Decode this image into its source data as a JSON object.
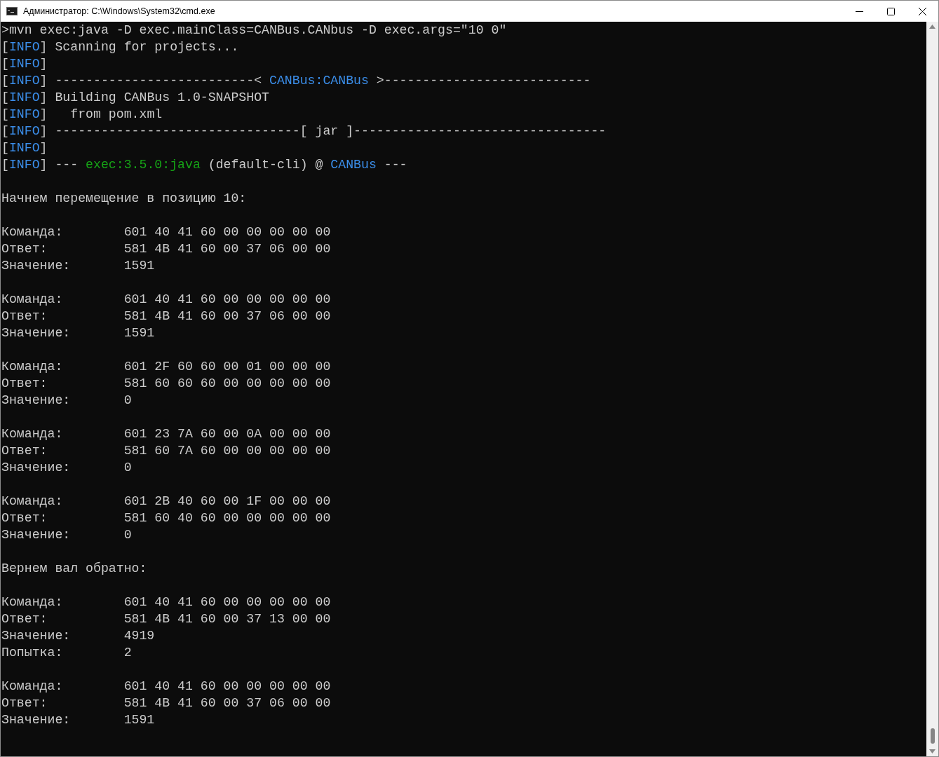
{
  "window": {
    "title": "Администратор: C:\\Windows\\System32\\cmd.exe"
  },
  "console": {
    "lines": [
      {
        "kind": "log",
        "segments": [
          {
            "text": ">mvn exec:java -D exec.mainClass=CANBus.CANbus -D exec.args=\"10 0\"",
            "kind": "plain"
          }
        ]
      },
      {
        "kind": "log",
        "segments": [
          {
            "text": "[",
            "kind": "plain"
          },
          {
            "text": "INFO",
            "kind": "accent"
          },
          {
            "text": "] Scanning for projects...",
            "kind": "plain"
          }
        ]
      },
      {
        "kind": "log",
        "segments": [
          {
            "text": "[",
            "kind": "plain"
          },
          {
            "text": "INFO",
            "kind": "accent"
          },
          {
            "text": "]",
            "kind": "plain"
          }
        ]
      },
      {
        "kind": "log",
        "segments": [
          {
            "text": "[",
            "kind": "plain"
          },
          {
            "text": "INFO",
            "kind": "accent"
          },
          {
            "text": "] --------------------------< ",
            "kind": "plain"
          },
          {
            "text": "CANBus:CANBus",
            "kind": "accent"
          },
          {
            "text": " >---------------------------",
            "kind": "plain"
          }
        ]
      },
      {
        "kind": "log",
        "segments": [
          {
            "text": "[",
            "kind": "plain"
          },
          {
            "text": "INFO",
            "kind": "accent"
          },
          {
            "text": "] Building CANBus 1.0-SNAPSHOT",
            "kind": "plain"
          }
        ]
      },
      {
        "kind": "log",
        "segments": [
          {
            "text": "[",
            "kind": "plain"
          },
          {
            "text": "INFO",
            "kind": "accent"
          },
          {
            "text": "]   from pom.xml",
            "kind": "plain"
          }
        ]
      },
      {
        "kind": "log",
        "segments": [
          {
            "text": "[",
            "kind": "plain"
          },
          {
            "text": "INFO",
            "kind": "accent"
          },
          {
            "text": "] --------------------------------[ jar ]---------------------------------",
            "kind": "plain"
          }
        ]
      },
      {
        "kind": "log",
        "segments": [
          {
            "text": "[",
            "kind": "plain"
          },
          {
            "text": "INFO",
            "kind": "accent"
          },
          {
            "text": "]",
            "kind": "plain"
          }
        ]
      },
      {
        "kind": "log",
        "segments": [
          {
            "text": "[",
            "kind": "plain"
          },
          {
            "text": "INFO",
            "kind": "accent"
          },
          {
            "text": "] --- ",
            "kind": "plain"
          },
          {
            "text": "exec:3.5.0:java",
            "kind": "success"
          },
          {
            "text": " (default-cli) @ ",
            "kind": "plain"
          },
          {
            "text": "CANBus",
            "kind": "accent"
          },
          {
            "text": " ---",
            "kind": "plain"
          }
        ]
      },
      {
        "kind": "blank"
      },
      {
        "kind": "log",
        "segments": [
          {
            "text": "Начнем перемещение в позицию 10:",
            "kind": "plain"
          }
        ]
      },
      {
        "kind": "blank"
      },
      {
        "kind": "field",
        "label": "Команда:",
        "value": "601 40 41 60 00 00 00 00 00"
      },
      {
        "kind": "field",
        "label": "Ответ:",
        "value": "581 4B 41 60 00 37 06 00 00"
      },
      {
        "kind": "field",
        "label": "Значение:",
        "value": "1591"
      },
      {
        "kind": "blank"
      },
      {
        "kind": "field",
        "label": "Команда:",
        "value": "601 40 41 60 00 00 00 00 00"
      },
      {
        "kind": "field",
        "label": "Ответ:",
        "value": "581 4B 41 60 00 37 06 00 00"
      },
      {
        "kind": "field",
        "label": "Значение:",
        "value": "1591"
      },
      {
        "kind": "blank"
      },
      {
        "kind": "field",
        "label": "Команда:",
        "value": "601 2F 60 60 00 01 00 00 00"
      },
      {
        "kind": "field",
        "label": "Ответ:",
        "value": "581 60 60 60 00 00 00 00 00"
      },
      {
        "kind": "field",
        "label": "Значение:",
        "value": "0"
      },
      {
        "kind": "blank"
      },
      {
        "kind": "field",
        "label": "Команда:",
        "value": "601 23 7A 60 00 0A 00 00 00"
      },
      {
        "kind": "field",
        "label": "Ответ:",
        "value": "581 60 7A 60 00 00 00 00 00"
      },
      {
        "kind": "field",
        "label": "Значение:",
        "value": "0"
      },
      {
        "kind": "blank"
      },
      {
        "kind": "field",
        "label": "Команда:",
        "value": "601 2B 40 60 00 1F 00 00 00"
      },
      {
        "kind": "field",
        "label": "Ответ:",
        "value": "581 60 40 60 00 00 00 00 00"
      },
      {
        "kind": "field",
        "label": "Значение:",
        "value": "0"
      },
      {
        "kind": "blank"
      },
      {
        "kind": "log",
        "segments": [
          {
            "text": "Вернем вал обратно:",
            "kind": "plain"
          }
        ]
      },
      {
        "kind": "blank"
      },
      {
        "kind": "field",
        "label": "Команда:",
        "value": "601 40 41 60 00 00 00 00 00"
      },
      {
        "kind": "field",
        "label": "Ответ:",
        "value": "581 4B 41 60 00 37 13 00 00"
      },
      {
        "kind": "field",
        "label": "Значение:",
        "value": "4919"
      },
      {
        "kind": "field",
        "label": "Попытка:",
        "value": "2"
      },
      {
        "kind": "blank"
      },
      {
        "kind": "field",
        "label": "Команда:",
        "value": "601 40 41 60 00 00 00 00 00"
      },
      {
        "kind": "field",
        "label": "Ответ:",
        "value": "581 4B 41 60 00 37 06 00 00"
      },
      {
        "kind": "field",
        "label": "Значение:",
        "value": "1591"
      }
    ]
  }
}
